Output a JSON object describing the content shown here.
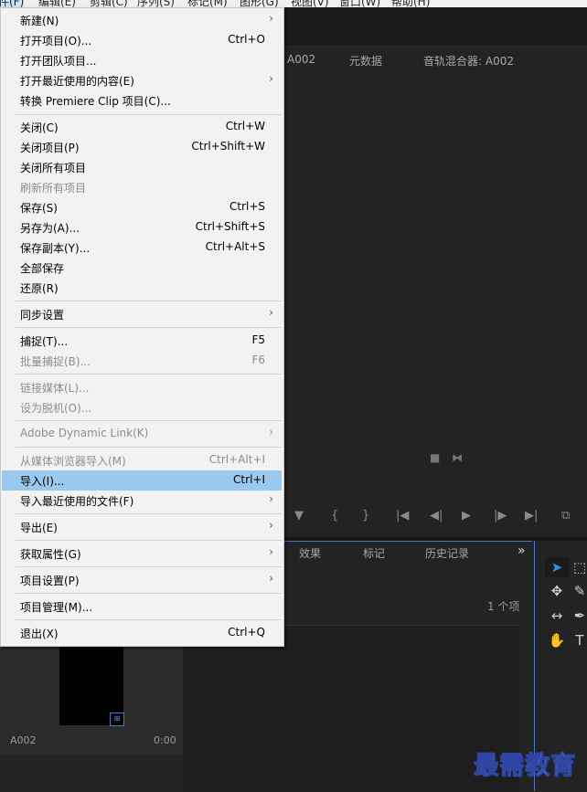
{
  "menubar": {
    "items": [
      "文件(F)",
      "编辑(E)",
      "剪辑(C)",
      "序列(S)",
      "标记(M)",
      "图形(G)",
      "视图(V)",
      "窗口(W)",
      "帮助(H)"
    ]
  },
  "monitor": {
    "tabs": [
      "A002",
      "元数据",
      "音轨混合器: A002"
    ],
    "small_icons": [
      "■",
      "⧓"
    ],
    "controls": [
      "▼",
      "{",
      "}",
      "|◀",
      "◀|",
      "▶",
      "|▶",
      "▶|",
      "⧉"
    ]
  },
  "project": {
    "tabs": [
      "效果",
      "标记",
      "历史记录"
    ],
    "overflow": "»",
    "item_count": "1 个项",
    "thumb": {
      "name": "A002",
      "duration": "0:00",
      "badge": "⊞"
    }
  },
  "menu": {
    "items": [
      {
        "label": "新建(N)",
        "shortcut": "",
        "submenu": true,
        "disabled": false
      },
      {
        "label": "打开项目(O)...",
        "shortcut": "Ctrl+O",
        "submenu": false,
        "disabled": false
      },
      {
        "label": "打开团队项目...",
        "shortcut": "",
        "submenu": false,
        "disabled": false
      },
      {
        "label": "打开最近使用的内容(E)",
        "shortcut": "",
        "submenu": true,
        "disabled": false
      },
      {
        "label": "转换 Premiere Clip 项目(C)...",
        "shortcut": "",
        "submenu": false,
        "disabled": false
      },
      {
        "label": "关闭(C)",
        "shortcut": "Ctrl+W",
        "submenu": false,
        "disabled": false
      },
      {
        "label": "关闭项目(P)",
        "shortcut": "Ctrl+Shift+W",
        "submenu": false,
        "disabled": false
      },
      {
        "label": "关闭所有项目",
        "shortcut": "",
        "submenu": false,
        "disabled": false
      },
      {
        "label": "刷新所有项目",
        "shortcut": "",
        "submenu": false,
        "disabled": true
      },
      {
        "label": "保存(S)",
        "shortcut": "Ctrl+S",
        "submenu": false,
        "disabled": false
      },
      {
        "label": "另存为(A)...",
        "shortcut": "Ctrl+Shift+S",
        "submenu": false,
        "disabled": false
      },
      {
        "label": "保存副本(Y)...",
        "shortcut": "Ctrl+Alt+S",
        "submenu": false,
        "disabled": false
      },
      {
        "label": "全部保存",
        "shortcut": "",
        "submenu": false,
        "disabled": false
      },
      {
        "label": "还原(R)",
        "shortcut": "",
        "submenu": false,
        "disabled": false
      },
      {
        "label": "同步设置",
        "shortcut": "",
        "submenu": true,
        "disabled": false
      },
      {
        "label": "捕捉(T)...",
        "shortcut": "F5",
        "submenu": false,
        "disabled": false
      },
      {
        "label": "批量捕捉(B)...",
        "shortcut": "F6",
        "submenu": false,
        "disabled": true
      },
      {
        "label": "链接媒体(L)...",
        "shortcut": "",
        "submenu": false,
        "disabled": true
      },
      {
        "label": "设为脱机(O)...",
        "shortcut": "",
        "submenu": false,
        "disabled": true
      },
      {
        "label": "Adobe Dynamic Link(K)",
        "shortcut": "",
        "submenu": true,
        "disabled": true
      },
      {
        "label": "从媒体浏览器导入(M)",
        "shortcut": "Ctrl+Alt+I",
        "submenu": false,
        "disabled": true
      },
      {
        "label": "导入(I)...",
        "shortcut": "Ctrl+I",
        "submenu": false,
        "disabled": false,
        "highlighted": true
      },
      {
        "label": "导入最近使用的文件(F)",
        "shortcut": "",
        "submenu": true,
        "disabled": false
      },
      {
        "label": "导出(E)",
        "shortcut": "",
        "submenu": true,
        "disabled": false
      },
      {
        "label": "获取属性(G)",
        "shortcut": "",
        "submenu": true,
        "disabled": false
      },
      {
        "label": "项目设置(P)",
        "shortcut": "",
        "submenu": true,
        "disabled": false
      },
      {
        "label": "项目管理(M)...",
        "shortcut": "",
        "submenu": false,
        "disabled": false
      },
      {
        "label": "退出(X)",
        "shortcut": "Ctrl+Q",
        "submenu": false,
        "disabled": false
      }
    ],
    "arrow_glyph": "›"
  },
  "tools": {
    "icons": [
      "selection-tool-icon",
      "track-select-icon",
      "ripple-edit-icon",
      "razor-icon",
      "slip-icon",
      "pen-icon",
      "hand-icon",
      "type-icon"
    ],
    "glyphs": [
      "➤",
      "⬚",
      "✥",
      "✎",
      "↔",
      "✒",
      "✋",
      "T"
    ]
  },
  "watermark": {
    "text": "最需教育"
  },
  "colors": {
    "highlight": "#99c9ef",
    "accent": "#3b7ac7",
    "panel": "#232323"
  }
}
